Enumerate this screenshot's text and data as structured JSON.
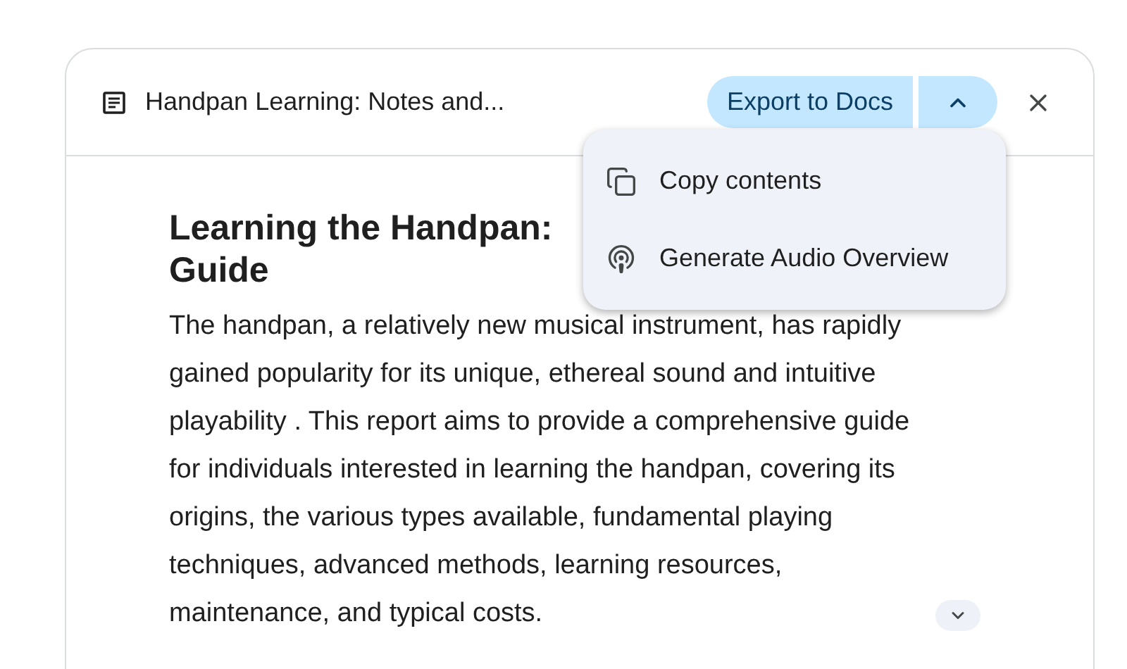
{
  "note": {
    "title": "Handpan Learning: Notes and...",
    "export_button": "Export to Docs",
    "menu_expanded": true,
    "heading_lines": [
      "Learning the Handpan:",
      "Guide"
    ],
    "body": "The handpan, a relatively new musical instrument, has rapidly gained popularity for its unique, ethereal sound and intuitive playability . This report aims to provide a comprehensive guide for individuals interested in learning the handpan, covering its origins, the various types available, fundamental playing techniques, advanced methods, learning resources, maintenance, and typical costs."
  },
  "menu": {
    "items": [
      {
        "kind": "copy",
        "label": "Copy contents"
      },
      {
        "kind": "audio",
        "label": "Generate Audio Overview"
      }
    ]
  }
}
